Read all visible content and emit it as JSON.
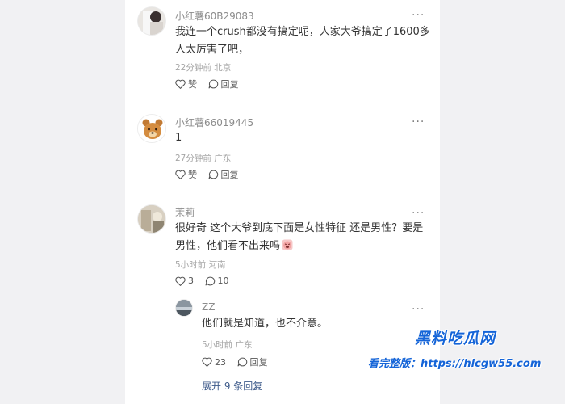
{
  "comments": [
    {
      "user": "小红薯60B29083",
      "text_lines": [
        "我连一个crush都没有搞定呢，人家大爷搞定了1600多",
        "人太厉害了吧，"
      ],
      "time": "22分钟前",
      "location": "北京",
      "like_label": "赞",
      "reply_label": "回复"
    },
    {
      "user": "小红薯66019445",
      "text_lines": [
        "1"
      ],
      "time": "27分钟前",
      "location": "广东",
      "like_label": "赞",
      "reply_label": "回复"
    },
    {
      "user": "茉莉",
      "text_lines": [
        "很好奇 这个大爷到底下面是女性特征 还是男性？要是",
        "男性，他们看不出来吗"
      ],
      "time": "5小时前",
      "location": "河南",
      "like_count": "3",
      "reply_count": "10"
    }
  ],
  "reply": {
    "user": "ZZ",
    "text": "他们就是知道，也不介意。",
    "time": "5小时前",
    "location": "广东",
    "like_count": "23",
    "reply_label": "回复"
  },
  "expand_label": "展开 9 条回复",
  "more_icon": "···",
  "watermark": {
    "title": "黑料吃瓜网",
    "url": "看完整版：https://hlcgw55.com"
  },
  "colors": {
    "background": "#f1f1f3",
    "card": "#ffffff",
    "username": "#8c8c8c",
    "text": "#333333",
    "meta": "#a6a6a6",
    "link": "#3d5a8a",
    "watermark": "#1464d8"
  }
}
